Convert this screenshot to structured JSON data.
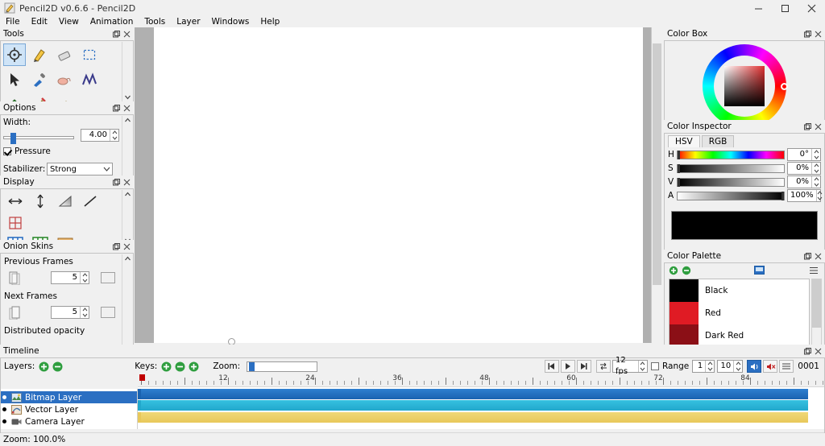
{
  "titlebar": {
    "title": "Pencil2D v0.6.6 - Pencil2D",
    "minimize": "─",
    "maximize": "□",
    "close": "✕"
  },
  "menubar": {
    "items": [
      "File",
      "Edit",
      "View",
      "Animation",
      "Tools",
      "Layer",
      "Windows",
      "Help"
    ]
  },
  "tools": {
    "title": "Tools",
    "items": [
      {
        "name": "move-tool",
        "selected": true
      },
      {
        "name": "brush-tool",
        "selected": false
      },
      {
        "name": "eraser-tool",
        "selected": false
      },
      {
        "name": "select-tool",
        "selected": false
      },
      {
        "name": "pointer-tool",
        "selected": false
      },
      {
        "name": "eyedropper-tool",
        "selected": false
      },
      {
        "name": "smudge-tool",
        "selected": false
      },
      {
        "name": "polyline-tool",
        "selected": false
      },
      {
        "name": "bucket-tool",
        "selected": false
      },
      {
        "name": "pen-tool",
        "selected": false
      },
      {
        "name": "pencil-tool",
        "selected": false
      }
    ]
  },
  "options": {
    "title": "Options",
    "width_label": "Width:",
    "width_value": "4.00",
    "pressure_label": "Pressure",
    "pressure_checked": true,
    "stabilizer_label": "Stabilizer:",
    "stabilizer_value": "Strong"
  },
  "display": {
    "title": "Display",
    "buttons": [
      "horizontal-flip-icon",
      "vertical-flip-icon",
      "gradient-icon",
      "line-icon",
      "overlay-center-icon",
      "grid-blue-icon",
      "grid-green-icon",
      "safe-area-icon"
    ]
  },
  "onion": {
    "title": "Onion Skins",
    "previous_label": "Previous Frames",
    "previous_value": "5",
    "next_label": "Next Frames",
    "next_value": "5",
    "distributed_label": "Distributed opacity"
  },
  "colorbox": {
    "title": "Color Box"
  },
  "inspector": {
    "title": "Color Inspector",
    "tabs": [
      "HSV",
      "RGB"
    ],
    "active_tab": "HSV",
    "channels": [
      {
        "label": "H",
        "value": "0°"
      },
      {
        "label": "S",
        "value": "0%"
      },
      {
        "label": "V",
        "value": "0%"
      },
      {
        "label": "A",
        "value": "100%"
      }
    ],
    "current_color": "#000000"
  },
  "palette": {
    "title": "Color Palette",
    "items": [
      {
        "name": "Black",
        "color": "#000000"
      },
      {
        "name": "Red",
        "color": "#e01b24"
      },
      {
        "name": "Dark Red",
        "color": "#8b0f16"
      }
    ]
  },
  "timeline": {
    "title": "Timeline",
    "layers_label": "Layers:",
    "keys_label": "Keys:",
    "zoom_label": "Zoom:",
    "fps_value": "12 fps",
    "range_label": "Range",
    "range_start": "1",
    "range_end": "10",
    "frame_number": "0001",
    "ruler_numbers": [
      "12",
      "24",
      "36",
      "48",
      "60",
      "72",
      "84"
    ],
    "layers": [
      {
        "name": "Bitmap Layer",
        "icon": "bitmap-layer-icon",
        "selected": true
      },
      {
        "name": "Vector Layer",
        "icon": "vector-layer-icon",
        "selected": false
      },
      {
        "name": "Camera Layer",
        "icon": "camera-layer-icon",
        "selected": false
      }
    ]
  },
  "statusbar": {
    "zoom_text": "Zoom: 100.0%"
  }
}
